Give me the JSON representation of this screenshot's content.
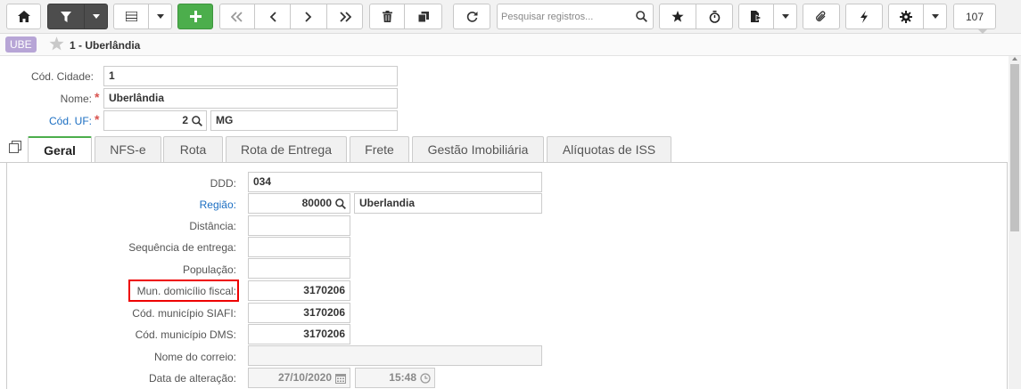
{
  "search": {
    "placeholder": "Pesquisar registros..."
  },
  "counter": "107",
  "header": {
    "badge": "UBE",
    "title": "1 - Uberlândia"
  },
  "form": {
    "cod_cidade": {
      "label": "Cód. Cidade:",
      "value": "1"
    },
    "nome": {
      "label": "Nome:",
      "value": "Uberlândia"
    },
    "cod_uf": {
      "label": "Cód. UF:",
      "value": "2",
      "desc": "MG"
    }
  },
  "tabs": [
    "Geral",
    "NFS-e",
    "Rota",
    "Rota de Entrega",
    "Frete",
    "Gestão Imobiliária",
    "Alíquotas de ISS"
  ],
  "geral": {
    "ddd": {
      "label": "DDD:",
      "value": "034"
    },
    "regiao": {
      "label": "Região:",
      "value": "80000",
      "desc": "Uberlandia"
    },
    "distancia": {
      "label": "Distância:",
      "value": ""
    },
    "seq_entrega": {
      "label": "Sequência de entrega:",
      "value": ""
    },
    "populacao": {
      "label": "População:",
      "value": ""
    },
    "mun_domicilio": {
      "label": "Mun. domicílio fiscal:",
      "value": "3170206"
    },
    "cod_siafi": {
      "label": "Cód. município SIAFI:",
      "value": "3170206"
    },
    "cod_dms": {
      "label": "Cód. município DMS:",
      "value": "3170206"
    },
    "nome_correio": {
      "label": "Nome do correio:",
      "value": ""
    },
    "data_alteracao": {
      "label": "Data de alteração:",
      "date": "27/10/2020",
      "time": "15:48"
    }
  },
  "colors": {
    "accent_green": "#4cae4c",
    "link_blue": "#1b6ec2",
    "highlight_red": "#e00000",
    "badge_purple": "#b7a5d6"
  }
}
